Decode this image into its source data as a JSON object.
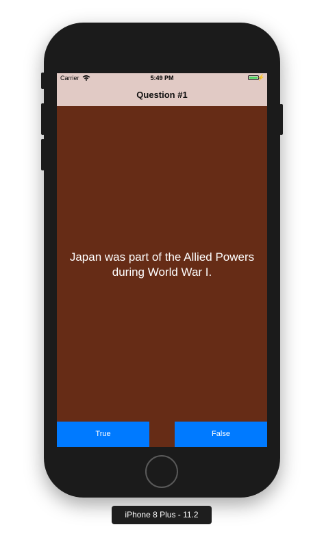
{
  "status_bar": {
    "carrier": "Carrier",
    "time": "5:49 PM",
    "wifi_icon": "wifi-icon",
    "battery_icon": "battery-icon",
    "charging_icon": "bolt-icon"
  },
  "nav": {
    "title": "Question #1"
  },
  "question": {
    "text": "Japan was part of the Allied Powers during World War I."
  },
  "answers": {
    "true_label": "True",
    "false_label": "False"
  },
  "simulator": {
    "device_label": "iPhone 8 Plus - 11.2"
  },
  "colors": {
    "background": "#662c16",
    "nav_bar": "#e1cac5",
    "button": "#007aff",
    "battery": "#4cd964"
  }
}
